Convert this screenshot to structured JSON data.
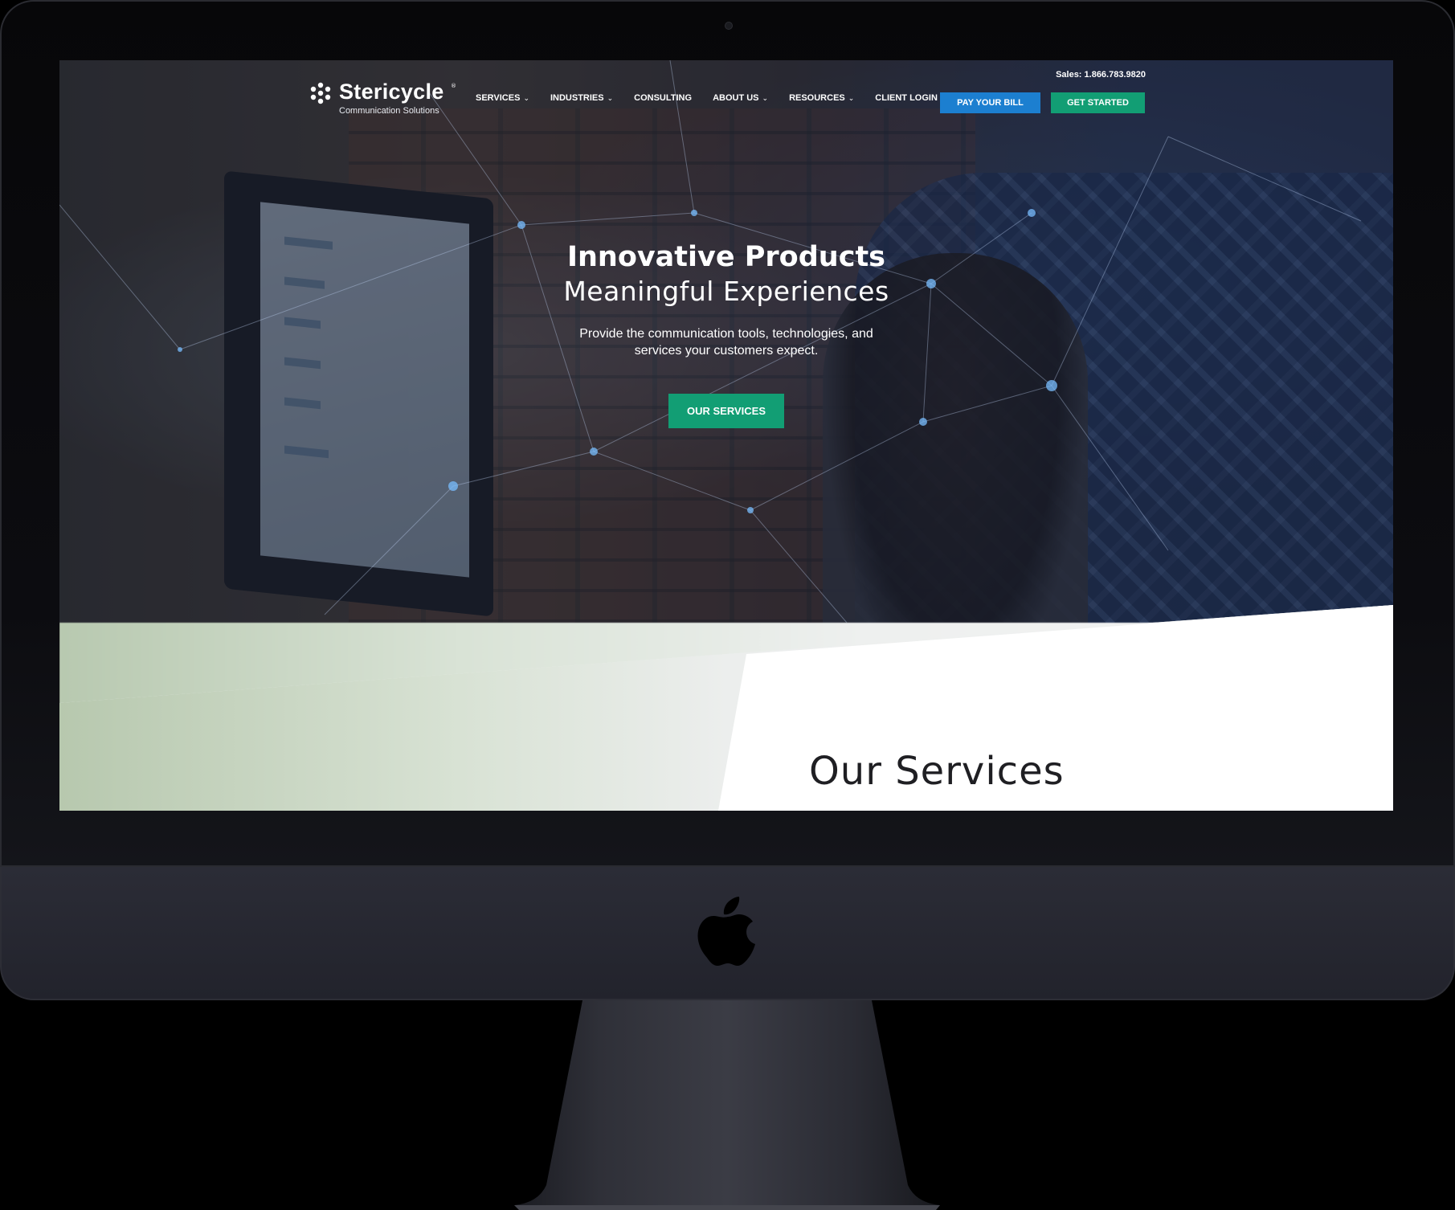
{
  "header": {
    "logo_name": "Stericycle",
    "logo_reg": "®",
    "logo_tagline": "Communication Solutions",
    "sales": "Sales: 1.866.783.9820"
  },
  "nav": {
    "items": [
      {
        "label": "SERVICES",
        "dropdown": true
      },
      {
        "label": "INDUSTRIES",
        "dropdown": true
      },
      {
        "label": "CONSULTING",
        "dropdown": false
      },
      {
        "label": "ABOUT US",
        "dropdown": true
      },
      {
        "label": "RESOURCES",
        "dropdown": true
      },
      {
        "label": "CLIENT LOGIN",
        "dropdown": false
      }
    ],
    "chevron": "⌄",
    "pay_bill_label": "PAY YOUR BILL",
    "get_started_label": "GET STARTED"
  },
  "hero": {
    "title": "Innovative Products",
    "subtitle": "Meaningful Experiences",
    "description": "Provide the communication tools, technologies, and services your customers expect.",
    "cta_label": "OUR SERVICES"
  },
  "services": {
    "title": "Our Services"
  },
  "colors": {
    "pay_bill_blue": "#1c7fd0",
    "accent_green": "#129e74",
    "device_body": "#25262f"
  },
  "icons": {
    "logo": "stericycle-dots-icon",
    "device": "apple-logo-icon",
    "nav_dropdown": "chevron-down-icon"
  }
}
